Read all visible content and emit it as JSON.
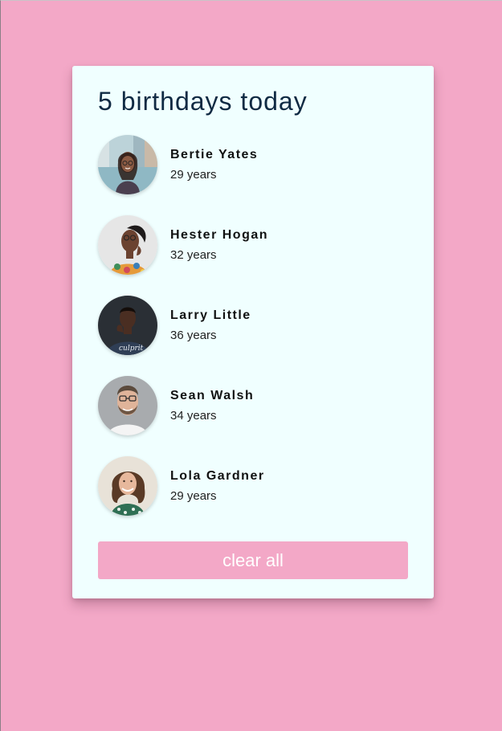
{
  "header": {
    "title": "5 birthdays today"
  },
  "people": [
    {
      "name": "Bertie Yates",
      "age": "29 years",
      "avatar_icon": "woman-with-glasses-city-photo"
    },
    {
      "name": "Hester Hogan",
      "age": "32 years",
      "avatar_icon": "woman-floral-shirt-photo"
    },
    {
      "name": "Larry Little",
      "age": "36 years",
      "avatar_icon": "man-dark-tshirt-photo"
    },
    {
      "name": "Sean Walsh",
      "age": "34 years",
      "avatar_icon": "man-glasses-beard-photo"
    },
    {
      "name": "Lola Gardner",
      "age": "29 years",
      "avatar_icon": "woman-curly-hair-photo"
    }
  ],
  "actions": {
    "clear_label": "clear all"
  },
  "colors": {
    "background": "#f3a8c7",
    "card": "#f0ffff",
    "title": "#102a43",
    "button": "#f3a8c7",
    "button_text": "#ffffff"
  }
}
